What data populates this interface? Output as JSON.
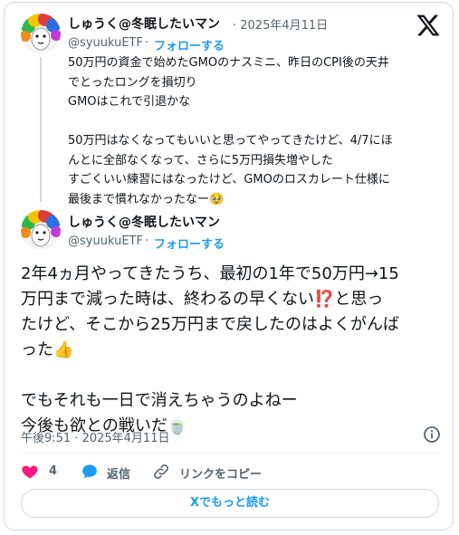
{
  "quoted_post": {
    "display_name": "しゅうく@冬眠したいマン",
    "date_text": "· 2025年4月11日",
    "handle": "@syuukuETF",
    "separator": "·",
    "follow_label": "フォローする",
    "text": "50万円の資金で始めたGMOのナスミニ、昨日のCPI後の天井\nでとったロングを損切り\nGMOはこれで引退かな\n\n50万円はなくなってもいいと思ってやってきたけど、4/7にほ\nんとに全部なくなって、さらに5万円損失増やした\nすごくいい練習にはなったけど、GMOのロスカレート仕様に\n最後まで慣れなかったなー🥹"
  },
  "main_post": {
    "display_name": "しゅうく@冬眠したいマン",
    "handle": "@syuukuETF",
    "separator": "·",
    "follow_label": "フォローする",
    "text": "2年4ヵ月やってきたうち、最初の1年で50万円→15\n万円まで減った時は、終わるの早くない⁉️と思っ\nたけど、そこから25万円まで戻したのはよくがんば\nった👍\n\nでもそれも一日で消えちゃうのよねー\n今後も欲との戦いだ🍵",
    "timestamp": "午後9:51 · 2025年4月11日"
  },
  "actions": {
    "like_count": "4",
    "reply_label": "返信",
    "copy_link_label": "リンクをコピー"
  },
  "read_more_label": "Xでもっと読む",
  "colors": {
    "accent": "#1d9bf0",
    "like": "#f91880",
    "text": "#0f1419",
    "muted": "#536471",
    "border": "#cfd9de"
  },
  "icons": {
    "logo": "x-logo-icon",
    "info": "info-icon",
    "like": "heart-icon",
    "reply": "reply-bubble-icon",
    "link": "link-icon"
  }
}
